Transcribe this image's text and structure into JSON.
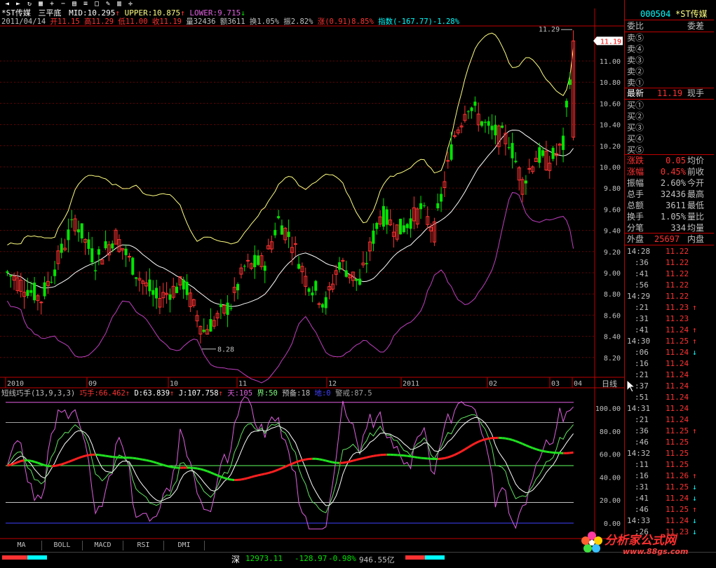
{
  "window": {
    "title": "*ST传媒",
    "stock_code": "000504"
  },
  "toolbar": {
    "icons": [
      "back-arrow-icon",
      "forward-arrow-icon",
      "refresh-icon",
      "grid-icon",
      "zoom-in-icon",
      "zoom-out-icon",
      "chart-icon",
      "list-icon",
      "window-icon",
      "tool-icon",
      "table-icon",
      "crosshair-icon"
    ]
  },
  "price_header": {
    "name": "*ST传媒",
    "indicator": "三平底",
    "mid_label": "MID:10.295",
    "upper_label": "UPPER:10.875",
    "lower_label": "LOWER:9.715"
  },
  "info_line": {
    "date": "2011/04/14",
    "open": "开11.15",
    "high": "高11.29",
    "low": "低11.00",
    "close": "收11.19",
    "volume": "量32436",
    "amount": "额3611",
    "turnover": "换1.05%",
    "amplitude": "振2.82%",
    "change": "涨(0.91)8.85%",
    "index": "指数(-167.77)-1.28%"
  },
  "price_axis": {
    "ticks": [
      "11.00",
      "10.80",
      "10.60",
      "10.40",
      "10.20",
      "10.00",
      "9.80",
      "9.60",
      "9.40",
      "9.20",
      "9.00",
      "8.80",
      "8.60",
      "8.40",
      "8.20"
    ],
    "current": "11.19",
    "high_label": "11.29",
    "low_label": "8.28"
  },
  "date_axis": {
    "labels": [
      "2010",
      "09",
      "10",
      "11",
      "12",
      "2011",
      "02",
      "03",
      "04"
    ],
    "period": "日线"
  },
  "indicator_header": {
    "name": "短线巧手(13,9,3,3)",
    "qiaoshou": "巧手:66.462",
    "d": "D:63.839",
    "j": "J:107.758",
    "tian": "天:105",
    "jie": "界:50",
    "yubei": "预备:18",
    "di": "地:0",
    "jingjie": "警戒:87.5"
  },
  "indicator_axis": {
    "ticks": [
      "100.00",
      "80.00",
      "60.00",
      "40.00",
      "20.00",
      "0.00"
    ]
  },
  "tabs": [
    "MA",
    "BOLL",
    "MACD",
    "RSI",
    "DMI"
  ],
  "status_bar": {
    "market": "深",
    "index_value": "12973.11",
    "index_change": "-128.97",
    "index_pct": "-0.98%",
    "amount": "946.55亿"
  },
  "quote_panel": {
    "code": "000504",
    "name": "*ST传媒",
    "weibi_label": "委比",
    "weicha_label": "委差",
    "sell": [
      "卖⑤",
      "卖④",
      "卖③",
      "卖②",
      "卖①"
    ],
    "latest_label": "最新",
    "latest_value": "11.19",
    "xianshou_label": "现手",
    "buy": [
      "买①",
      "买②",
      "买③",
      "买④",
      "买⑤"
    ],
    "stats": [
      {
        "label": "涨跌",
        "value": "0.05",
        "label2": "均价"
      },
      {
        "label": "涨幅",
        "value": "0.45%",
        "label2": "前收"
      },
      {
        "label": "振幅",
        "value": "2.60%",
        "label2": "今开"
      },
      {
        "label": "总手",
        "value": "32436",
        "label2": "最高"
      },
      {
        "label": "总额",
        "value": "3611",
        "label2": "最低"
      },
      {
        "label": "换手",
        "value": "1.05%",
        "label2": "量比"
      },
      {
        "label": "分笔",
        "value": "334",
        "label2": "均量"
      }
    ],
    "waipan_label": "外盘",
    "waipan_value": "25697",
    "neipan_label": "内盘"
  },
  "ticks_list": [
    {
      "time": "14:28",
      "price": "11.22",
      "dir": ""
    },
    {
      "time": ":36",
      "price": "11.22",
      "dir": ""
    },
    {
      "time": ":41",
      "price": "11.22",
      "dir": ""
    },
    {
      "time": ":56",
      "price": "11.22",
      "dir": ""
    },
    {
      "time": "14:29",
      "price": "11.22",
      "dir": ""
    },
    {
      "time": ":21",
      "price": "11.23",
      "dir": "up"
    },
    {
      "time": ":31",
      "price": "11.23",
      "dir": ""
    },
    {
      "time": ":41",
      "price": "11.24",
      "dir": "up"
    },
    {
      "time": "14:30",
      "price": "11.25",
      "dir": "up"
    },
    {
      "time": ":06",
      "price": "11.24",
      "dir": "down"
    },
    {
      "time": ":16",
      "price": "11.24",
      "dir": ""
    },
    {
      "time": ":21",
      "price": "11.24",
      "dir": ""
    },
    {
      "time": ":37",
      "price": "11.24",
      "dir": ""
    },
    {
      "time": ":51",
      "price": "11.24",
      "dir": ""
    },
    {
      "time": "14:31",
      "price": "11.24",
      "dir": ""
    },
    {
      "time": ":21",
      "price": "11.24",
      "dir": ""
    },
    {
      "time": ":36",
      "price": "11.25",
      "dir": "up"
    },
    {
      "time": ":46",
      "price": "11.25",
      "dir": ""
    },
    {
      "time": "14:32",
      "price": "11.25",
      "dir": ""
    },
    {
      "time": ":11",
      "price": "11.25",
      "dir": ""
    },
    {
      "time": ":16",
      "price": "11.26",
      "dir": "up"
    },
    {
      "time": ":31",
      "price": "11.25",
      "dir": "down"
    },
    {
      "time": ":41",
      "price": "11.24",
      "dir": "down"
    },
    {
      "time": ":46",
      "price": "11.25",
      "dir": "up"
    },
    {
      "time": "14:33",
      "price": "11.24",
      "dir": "down"
    },
    {
      "time": ":26",
      "price": "11.23",
      "dir": "down"
    }
  ],
  "logo": {
    "text": "分析家公式网",
    "url_text": "www.88gs.com"
  },
  "colors": {
    "up": "#ff3232",
    "down": "#00e600",
    "grid": "#8b0000",
    "mid": "#ffffff",
    "upper": "#ffff80",
    "lower": "#c040c0",
    "cyan": "#00ffff"
  }
}
